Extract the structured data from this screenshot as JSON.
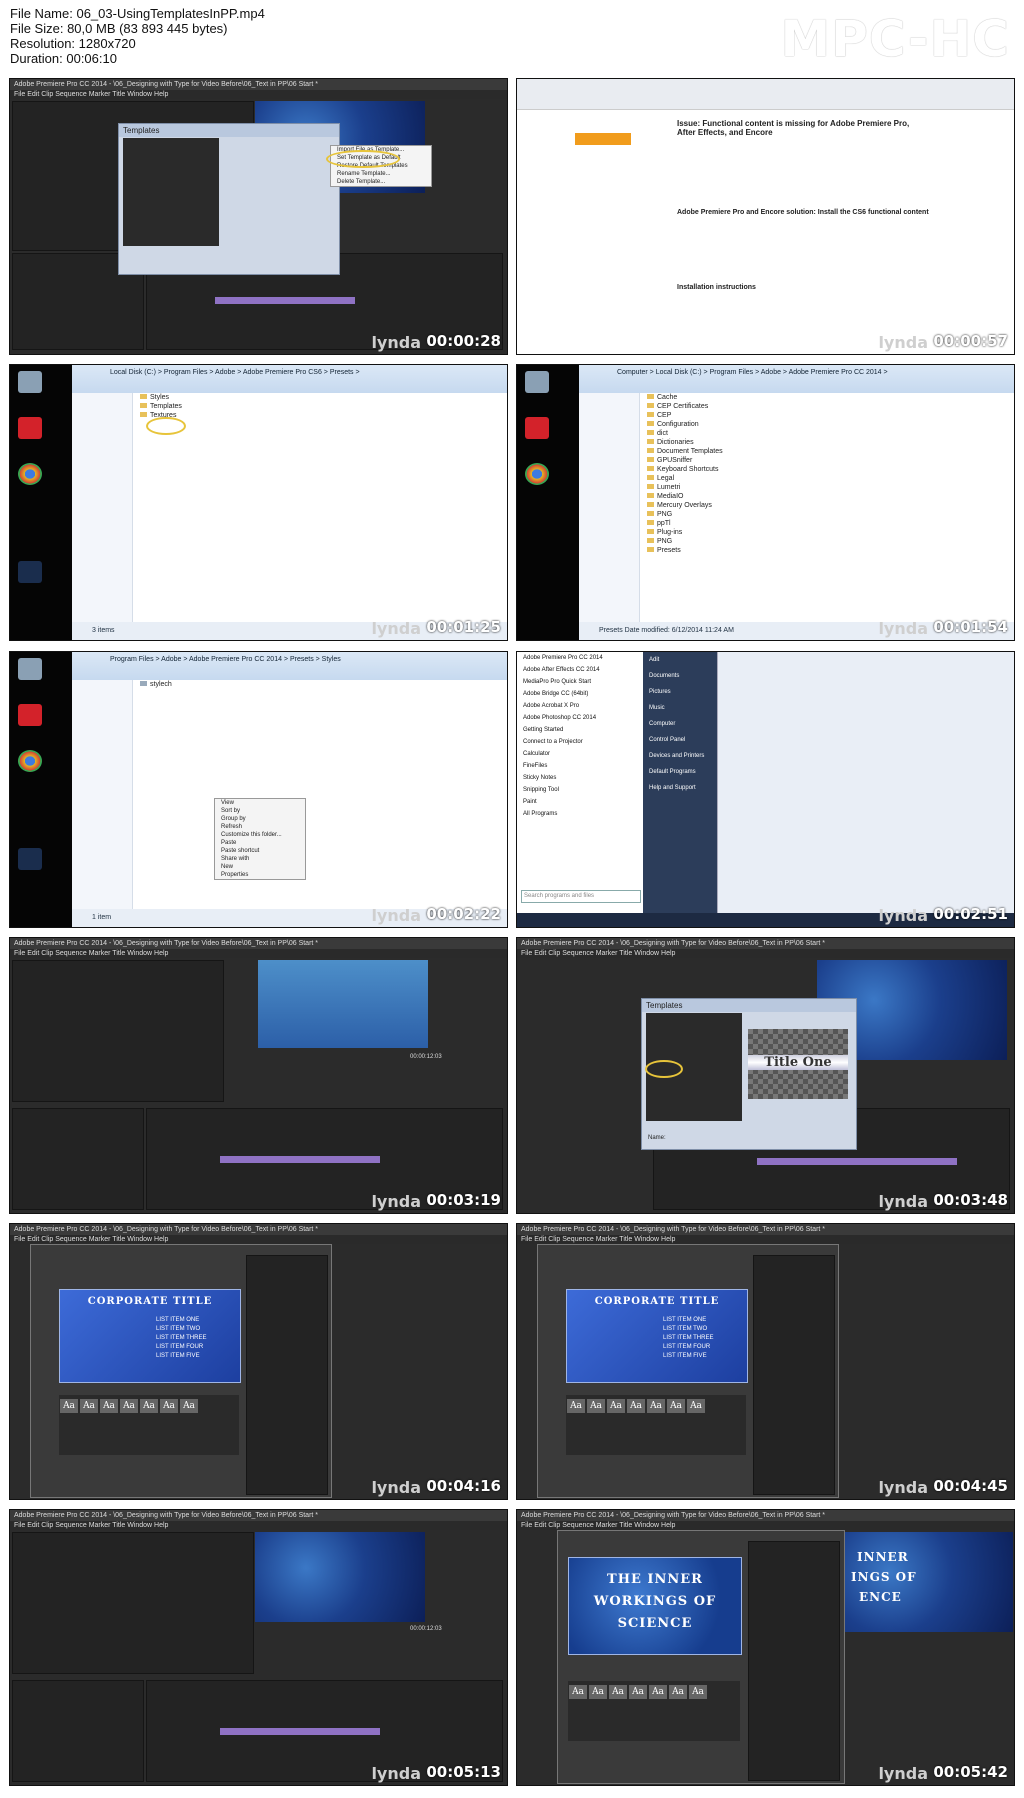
{
  "header": {
    "file_name_line": "File Name: 06_03-UsingTemplatesInPP.mp4",
    "file_size_line": "File Size: 80,0 MB (83 893 445 bytes)",
    "resolution_line": "Resolution: 1280x720",
    "duration_line": "Duration: 00:06:10",
    "brand": "MPC-HC"
  },
  "watermark": "lynda",
  "frames": [
    {
      "time": "00:00:28",
      "app_title": "Adobe Premiere Pro CC 2014 - \\06_Designing with Type for Video Before\\06_Text in PP\\06 Start *",
      "dialog_title": "Templates",
      "menu_items": [
        "Import File as Template...",
        "Set Template as Default",
        "Restore Default Templates",
        "Rename Template...",
        "Delete Template..."
      ]
    },
    {
      "time": "00:00:57",
      "page_heading": "Issue: Functional content is missing for Adobe Premiere Pro, After Effects, and Encore",
      "section_heading": "Adobe Premiere Pro and Encore solution: Install the CS6 functional content",
      "sub_heading": "Installation instructions"
    },
    {
      "time": "00:01:25",
      "path": "Local Disk (C:) > Program Files > Adobe > Adobe Premiere Pro CS6 > Presets >",
      "items": [
        "Styles",
        "Templates",
        "Textures"
      ],
      "status": "3 items"
    },
    {
      "time": "00:01:54",
      "path": "Computer > Local Disk (C:) > Program Files > Adobe > Adobe Premiere Pro CC 2014 >",
      "items": [
        "Cache",
        "CEP Certificates",
        "CEP",
        "Configuration",
        "dict",
        "Dictionaries",
        "Document Templates",
        "GPUSniffer",
        "Keyboard Shortcuts",
        "Legal",
        "Lumetri",
        "MediaIO",
        "Mercury Overlays",
        "PNG",
        "ppTl",
        "Plug-ins",
        "PNG",
        "Presets"
      ],
      "status": "Presets  Date modified: 6/12/2014 11:24 AM"
    },
    {
      "time": "00:02:22",
      "path": "Program Files > Adobe > Adobe Premiere Pro CC 2014 > Presets > Styles",
      "items": [
        "stylech"
      ],
      "context_menu": [
        "View",
        "Sort by",
        "Group by",
        "Refresh",
        "Customize this folder...",
        "Paste",
        "Paste shortcut",
        "Share with",
        "New",
        "Properties"
      ],
      "status": "1 item"
    },
    {
      "time": "00:02:51",
      "start_menu_left": [
        "Adobe Premiere Pro CC 2014",
        "Adobe After Effects CC 2014",
        "MediaPro Pro Quick Start",
        "Adobe Bridge CC (64bit)",
        "Adobe Acrobat X Pro",
        "Adobe Photoshop CC 2014",
        "Getting Started",
        "Connect to a Projector",
        "Calculator",
        "FineFiles",
        "Sticky Notes",
        "Snipping Tool",
        "Paint",
        "All Programs"
      ],
      "start_menu_right": [
        "Adit",
        "Documents",
        "Pictures",
        "Music",
        "Computer",
        "Control Panel",
        "Devices and Printers",
        "Default Programs",
        "Help and Support"
      ],
      "search_placeholder": "Search programs and files"
    },
    {
      "time": "00:03:19",
      "timecode": "00:00:12:03"
    },
    {
      "time": "00:03:48",
      "dialog_title": "Templates",
      "preview_text": "Title One",
      "name_label": "Name:"
    },
    {
      "time": "00:04:16",
      "card_title": "CORPORATE TITLE",
      "list_items": [
        "LIST ITEM ONE",
        "LIST ITEM TWO",
        "LIST ITEM THREE",
        "LIST ITEM FOUR",
        "LIST ITEM FIVE"
      ]
    },
    {
      "time": "00:04:45",
      "card_title": "CORPORATE TITLE",
      "list_items": [
        "LIST ITEM ONE",
        "LIST ITEM TWO",
        "LIST ITEM THREE",
        "LIST ITEM FOUR",
        "LIST ITEM FIVE"
      ]
    },
    {
      "time": "00:05:13",
      "timecode": "00:00:12:03"
    },
    {
      "time": "00:05:42",
      "card_lines": [
        "THE INNER",
        "WORKINGS OF",
        "SCIENCE"
      ],
      "side_text": [
        "INNER",
        "INGS OF",
        "ENCE"
      ]
    }
  ]
}
